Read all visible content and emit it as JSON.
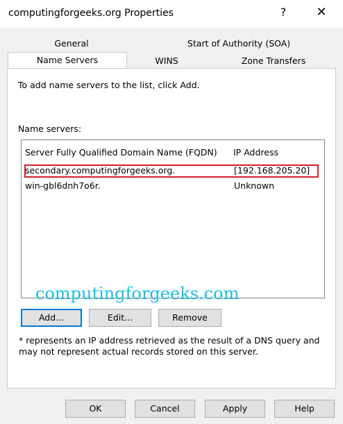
{
  "window": {
    "title": "computingforgeeks.org Properties",
    "help_glyph": "?",
    "close_glyph": "✕"
  },
  "tabs": {
    "row1": [
      {
        "label": "General"
      },
      {
        "label": "Start of Authority (SOA)"
      }
    ],
    "row2": [
      {
        "label": "Name Servers",
        "active": true
      },
      {
        "label": "WINS"
      },
      {
        "label": "Zone Transfers"
      }
    ]
  },
  "panel": {
    "instruction": "To add name servers to the list, click Add.",
    "list_label": "Name servers:",
    "columns": [
      "Server Fully Qualified Domain Name (FQDN)",
      "IP Address"
    ],
    "rows": [
      {
        "fqdn": "secondary.computingforgeeks.org.",
        "ip": "[192.168.205.20]",
        "highlighted": true
      },
      {
        "fqdn": "win-gbl6dnh7o6r.",
        "ip": "Unknown",
        "highlighted": false
      }
    ],
    "watermark": "computingforgeeks.com",
    "buttons": {
      "add": "Add...",
      "edit": "Edit...",
      "remove": "Remove"
    },
    "note": "* represents an IP address retrieved as the result of a DNS query and may not represent actual records stored on this server."
  },
  "footer": {
    "ok": "OK",
    "cancel": "Cancel",
    "apply": "Apply",
    "help": "Help"
  },
  "colors": {
    "highlight_border": "#d81e2c",
    "watermark": "#19bfe6",
    "focus_border": "#0078d7"
  }
}
